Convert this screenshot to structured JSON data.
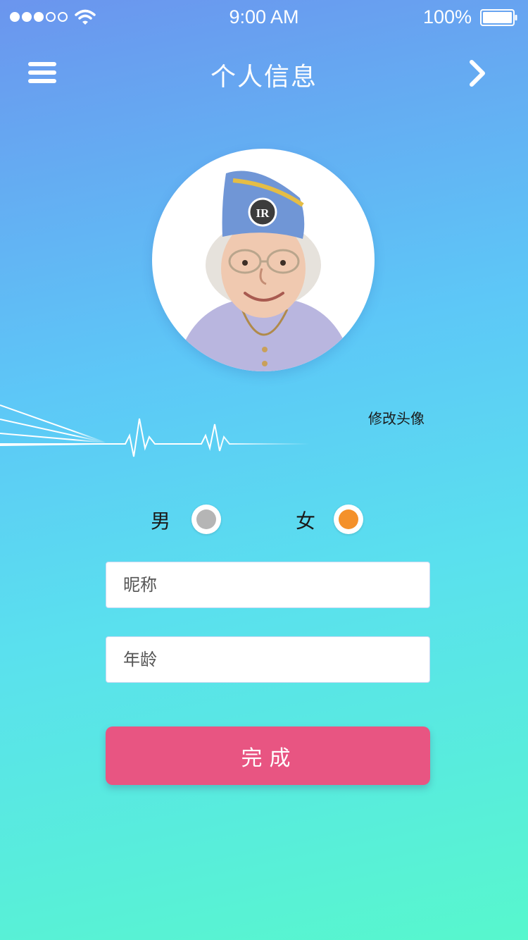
{
  "status_bar": {
    "time": "9:00 AM",
    "battery": "100%",
    "signal_icon": "signal-dots-icon",
    "wifi_icon": "wifi-icon",
    "battery_icon": "battery-icon"
  },
  "nav": {
    "title": "个人信息",
    "menu_icon": "hamburger-menu-icon",
    "next_icon": "chevron-right-icon"
  },
  "profile": {
    "change_avatar_label": "修改头像"
  },
  "gender": {
    "male_label": "男",
    "female_label": "女",
    "male_color": "#b5b5b5",
    "female_color": "#f4912b",
    "selected": "女"
  },
  "form": {
    "nickname_placeholder": "昵称",
    "age_placeholder": "年龄",
    "submit_label": "完成"
  },
  "colors": {
    "submit": "#e85582",
    "gradient_top": "#6b95ee",
    "gradient_bottom": "#57f7cd"
  }
}
